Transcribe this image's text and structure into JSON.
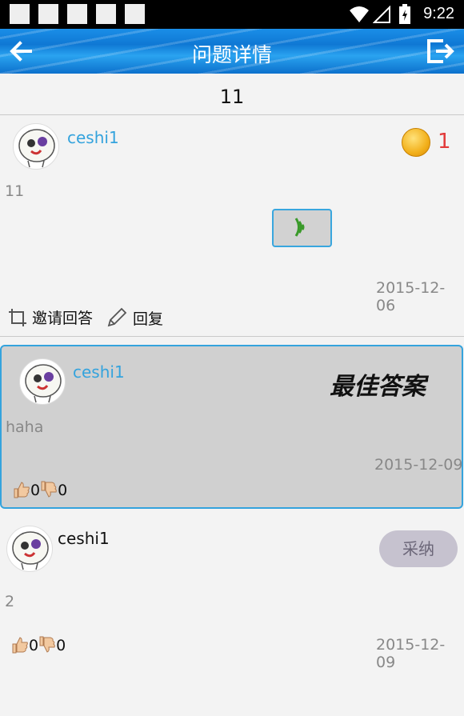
{
  "status_bar": {
    "time": "9:22"
  },
  "header": {
    "title": "问题详情",
    "back_icon": "arrow-left-icon",
    "exit_icon": "exit-icon"
  },
  "question": {
    "title": "11",
    "user": "ceshi1",
    "reward": "1",
    "content": "11",
    "date": "2015-12-06",
    "invite_label": "邀请回答",
    "reply_label": "回复"
  },
  "answers": [
    {
      "user": "ceshi1",
      "content": "haha",
      "date": "2015-12-09",
      "likes": "0",
      "dislikes": "0",
      "badge": "最佳答案",
      "best": true
    },
    {
      "user": "ceshi1",
      "content": "2",
      "date": "2015-12-09",
      "likes": "0",
      "dislikes": "0",
      "adopt_label": "采纳",
      "best": false
    }
  ],
  "colors": {
    "accent": "#34a3dd",
    "username": "#34a3dd",
    "reward": "#e23b3b"
  }
}
